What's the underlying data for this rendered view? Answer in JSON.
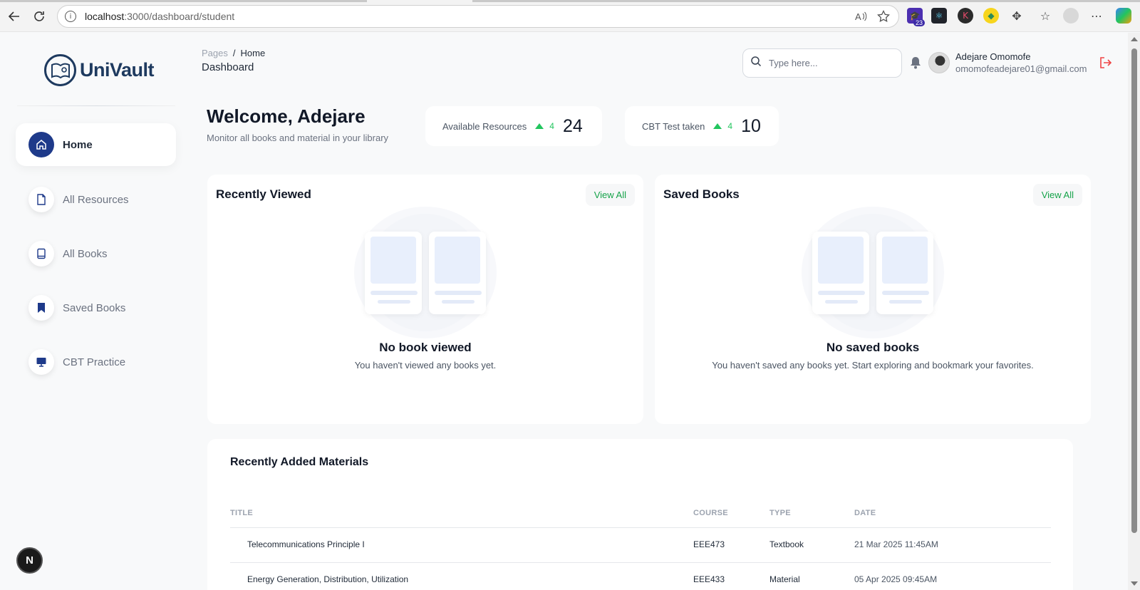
{
  "browser": {
    "url_host": "localhost",
    "url_path": ":3000/dashboard/student",
    "ext_badge": "23"
  },
  "sidebar": {
    "logo_text": "UniVault",
    "items": [
      {
        "label": "Home",
        "icon": "home-icon",
        "active": true
      },
      {
        "label": "All Resources",
        "icon": "file-icon",
        "active": false
      },
      {
        "label": "All Books",
        "icon": "book-icon",
        "active": false
      },
      {
        "label": "Saved Books",
        "icon": "bookmark-icon",
        "active": false
      },
      {
        "label": "CBT Practice",
        "icon": "monitor-icon",
        "active": false
      }
    ],
    "fab_label": "N"
  },
  "header": {
    "breadcrumb_root": "Pages",
    "breadcrumb_sep": "/",
    "breadcrumb_current": "Home",
    "page_title": "Dashboard",
    "search_placeholder": "Type here...",
    "user_name": "Adejare Omomofe",
    "user_email": "omomofeadejare01@gmail.com"
  },
  "welcome": {
    "title": "Welcome, Adejare",
    "subtitle": "Monitor all books and material in your library"
  },
  "stats": [
    {
      "label": "Available Resources",
      "delta": "4",
      "value": "24"
    },
    {
      "label": "CBT Test taken",
      "delta": "4",
      "value": "10"
    }
  ],
  "recently_viewed": {
    "title": "Recently Viewed",
    "view_all": "View All",
    "empty_title": "No book viewed",
    "empty_sub": "You haven't viewed any books yet."
  },
  "saved_books": {
    "title": "Saved Books",
    "view_all": "View All",
    "empty_title": "No saved books",
    "empty_sub": "You haven't saved any books yet. Start exploring and bookmark your favorites."
  },
  "materials": {
    "title": "Recently Added Materials",
    "columns": [
      "TITLE",
      "COURSE",
      "TYPE",
      "DATE"
    ],
    "rows": [
      [
        "Telecommunications Principle I",
        "EEE473",
        "Textbook",
        "21 Mar 2025 11:45AM"
      ],
      [
        "Energy Generation, Distribution, Utilization",
        "EEE433",
        "Material",
        "05 Apr 2025 09:45AM"
      ]
    ]
  },
  "colors": {
    "accent": "#1e3a8a",
    "positive": "#22c55e",
    "link": "#16a34a",
    "logout": "#ef4444"
  }
}
